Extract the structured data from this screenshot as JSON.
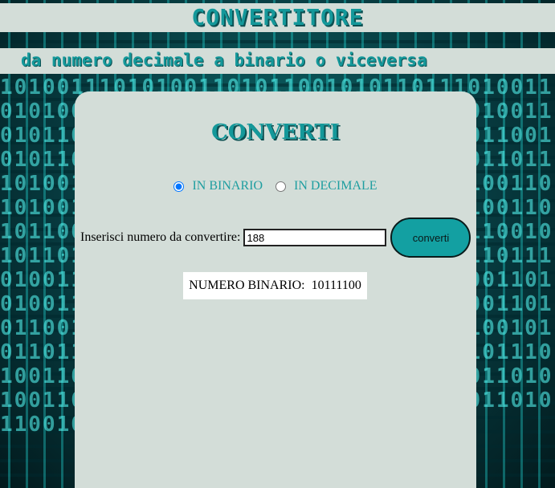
{
  "header": {
    "title": "CONVERTITORE",
    "subtitle": "da numero decimale a binario o viceversa"
  },
  "background": {
    "digits": "1010011101010011010110010101101110100110101001101011001010110111010011010100110101100101011011101001101010011010110010101101110100110101001101011001010110111010011010100110101100101011011101001101010011010110010101101110100110101001101011001010110111010011010100110101100101011011101001101010011010110010101101110100110101001101011001010110111010011010100110101100101011011101001101010011010110010101101110100110101001101011001010110111010011010100110101100101011011101001101010011010110010101101110100110101001101011001010110111010011010100110101100101011011"
  },
  "card": {
    "title": "CONVERTI",
    "options": {
      "binary_label": "IN BINARIO",
      "decimal_label": "IN DECIMALE",
      "selected": "binary"
    },
    "input_label": "Inserisci numero da convertire:",
    "input_value": "188",
    "button_label": "converti",
    "result_text": "NUMERO BINARIO:  10111100"
  },
  "colors": {
    "accent": "#14989a",
    "panel": "#d3ddd8",
    "button": "#13a0a2"
  }
}
